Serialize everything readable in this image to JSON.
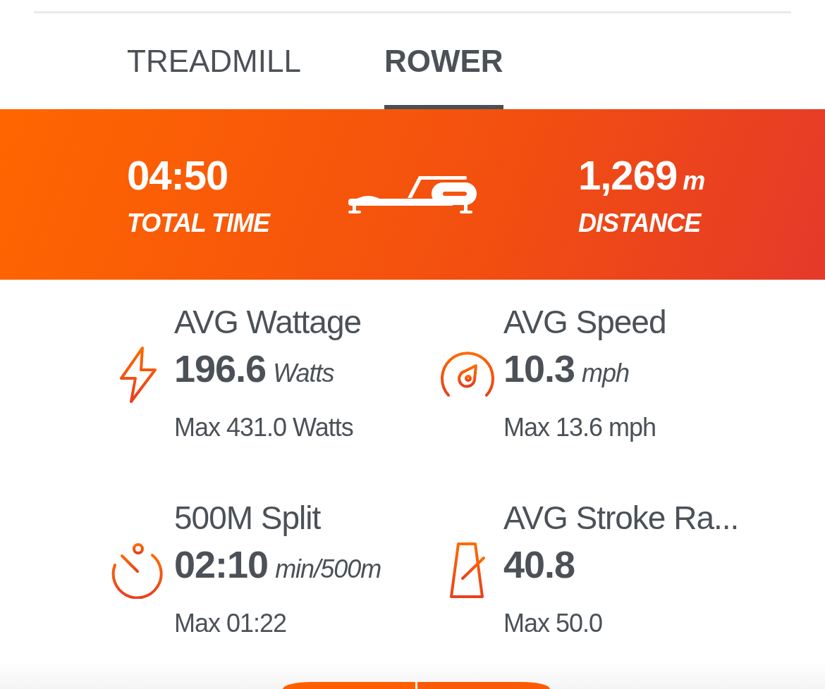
{
  "tabs": [
    {
      "label": "TREADMILL",
      "selected": false
    },
    {
      "label": "ROWER",
      "selected": true
    }
  ],
  "summary": {
    "time": {
      "value": "04:50",
      "label": "TOTAL TIME"
    },
    "distance": {
      "value": "1,269",
      "unit": "m",
      "label": "DISTANCE"
    }
  },
  "stats": [
    {
      "kind": "power",
      "label": "AVG Wattage",
      "value": "196.6",
      "unit": "Watts",
      "max": "Max 431.0 Watts"
    },
    {
      "kind": "speed",
      "label": "AVG Speed",
      "value": "10.3",
      "unit": "mph",
      "max": "Max 13.6 mph"
    },
    {
      "kind": "split",
      "label": "500M Split",
      "value": "02:10",
      "unit": "min/500m",
      "max": "Max 01:22"
    },
    {
      "kind": "stroke",
      "label": "AVG Stroke Ra...",
      "value": "40.8",
      "max": "Max 50.0"
    }
  ]
}
